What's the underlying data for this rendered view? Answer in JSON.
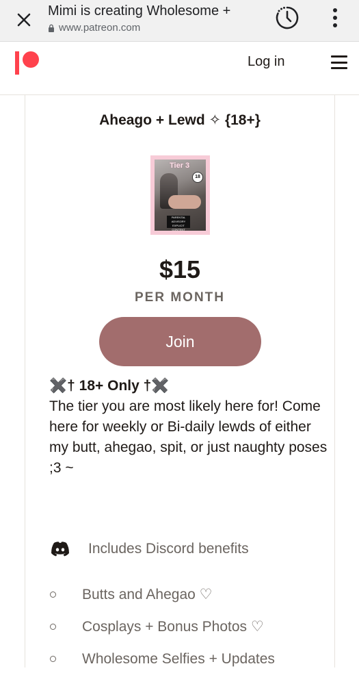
{
  "browser": {
    "title": "Mimi is creating Wholesome +",
    "url": "www.patreon.com",
    "icons": {
      "close": "close-icon",
      "lock": "lock-icon",
      "history": "history-icon",
      "menu": "more-vert-icon"
    }
  },
  "header": {
    "login_label": "Log in",
    "logo": "patreon-logo",
    "menu_icon": "hamburger-icon",
    "brand_color": "#ff424d"
  },
  "tier": {
    "title": "Aheago + Lewd ✧ {18+}",
    "image": {
      "label": "Tier 3",
      "badge": "18",
      "advisory": "PARENTAL ADVISORY EXPLICIT CONTENT"
    },
    "price": "$15",
    "period": "PER MONTH",
    "join_label": "Join",
    "join_color": "#a26d6d",
    "description_headline": "✖️† 18+ Only †✖️",
    "description_body": "The tier you are most likely here for! Come here for weekly or Bi-daily lewds of either my butt, ahegao, spit, or just naughty poses ;3 ~",
    "discord_benefit": "Includes Discord benefits",
    "benefits": [
      "Butts and Ahegao ♡",
      "Cosplays + Bonus Photos ♡",
      "Wholesome Selfies + Updates"
    ]
  }
}
